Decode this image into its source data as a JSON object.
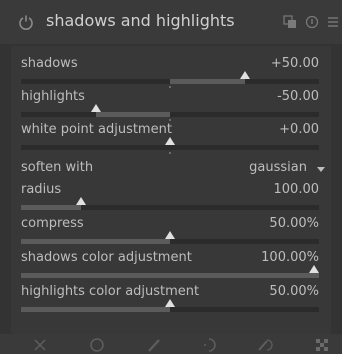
{
  "module": {
    "title": "shadows and highlights"
  },
  "sliders": [
    {
      "label": "shadows",
      "value_text": "+50.00",
      "value": 50,
      "min": -100,
      "max": 100
    },
    {
      "label": "highlights",
      "value_text": "-50.00",
      "value": -50,
      "min": -100,
      "max": 100
    },
    {
      "label": "white point adjustment",
      "value_text": "+0.00",
      "value": 0,
      "min": -10,
      "max": 10
    }
  ],
  "soften": {
    "label": "soften with",
    "value": "gaussian"
  },
  "sliders2": [
    {
      "label": "radius",
      "value_text": "100.00",
      "value": 100,
      "min": 0,
      "max": 500
    },
    {
      "label": "compress",
      "value_text": "50.00%",
      "value": 50,
      "min": 0,
      "max": 100
    },
    {
      "label": "shadows color adjustment",
      "value_text": "100.00%",
      "value": 100,
      "min": 0,
      "max": 100
    },
    {
      "label": "highlights color adjustment",
      "value_text": "50.00%",
      "value": 50,
      "min": 0,
      "max": 100
    }
  ],
  "icons": {
    "header": [
      "power-icon",
      "multi-instance-icon",
      "reset-icon",
      "presets-icon"
    ],
    "bottom": [
      "off-icon",
      "uniform-mask-icon",
      "drawn-mask-icon",
      "parametric-mask-icon",
      "drawn-parametric-mask-icon",
      "raster-mask-icon"
    ]
  },
  "colors": {
    "knob": "#e0e0e0",
    "fill": "#5b5b5b",
    "track": "#2b2b2b"
  }
}
